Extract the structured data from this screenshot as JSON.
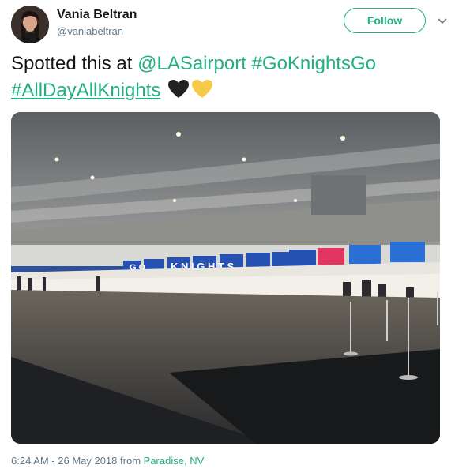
{
  "user": {
    "name": "Vania Beltran",
    "handle": "@vaniabeltran"
  },
  "actions": {
    "follow_label": "Follow",
    "more_icon": "chevron-down-icon"
  },
  "tweet": {
    "text_prefix": "Spotted this at ",
    "mention": "@LASairport",
    "hashtag1": "#GoKnightsGo",
    "hashtag2": "#AllDayAllKnights",
    "emoji_hearts": [
      "black-heart",
      "yellow-heart"
    ]
  },
  "photo": {
    "sign_letters": [
      "G",
      "O",
      "K",
      "N",
      "I",
      "G",
      "H",
      "T",
      "S"
    ]
  },
  "meta": {
    "timestamp": "6:24 AM - 26 May 2018 from",
    "place": "Paradise, NV"
  },
  "colors": {
    "accent": "#22b07d",
    "secondary_text": "#657786",
    "black_heart": "#222222",
    "yellow_heart": "#f7c948"
  }
}
